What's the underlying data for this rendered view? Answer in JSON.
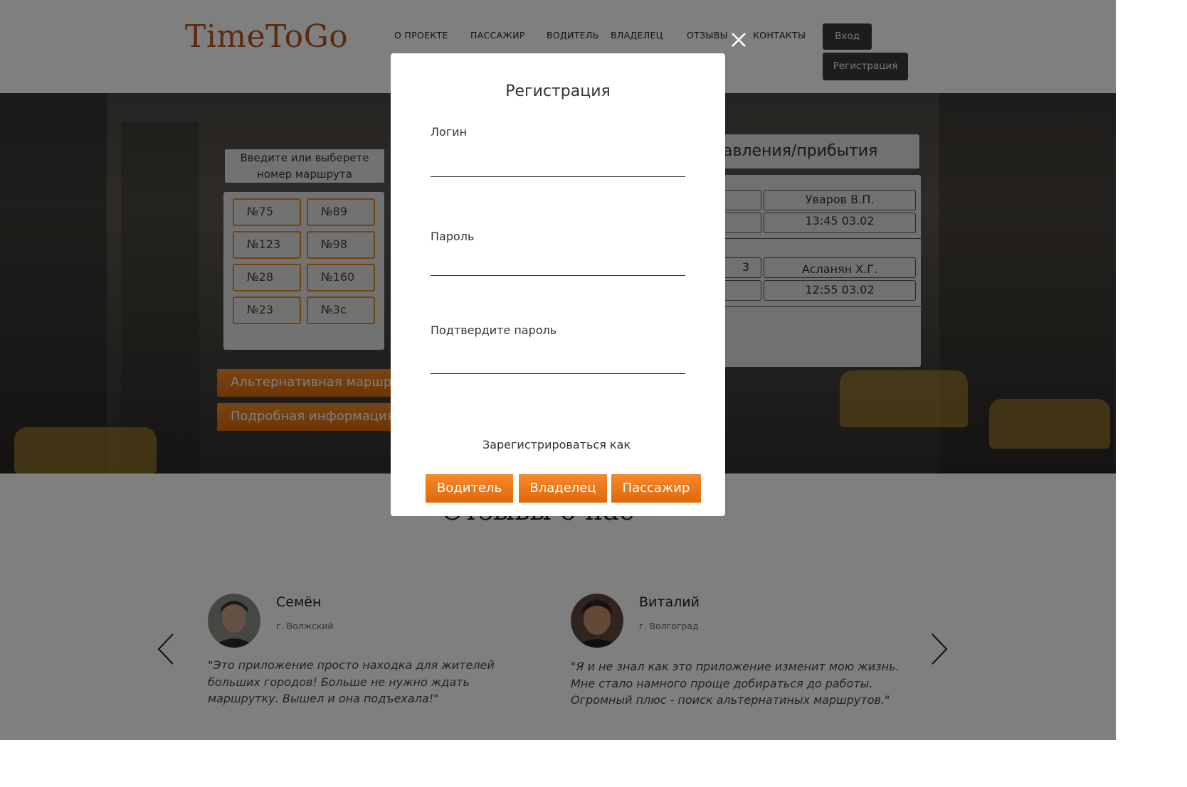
{
  "header": {
    "logo": "TimeToGo",
    "nav": [
      "О ПРОЕКТЕ",
      "ПАССАЖИР",
      "ВОДИТЕЛЬ",
      "ВЛАДЕЛЕЦ",
      "ОТЗЫВЫ",
      "КОНТАКТЫ"
    ],
    "login_label": "Вход",
    "register_label": "Регистрация"
  },
  "hero": {
    "route_prompt_line1": "Введите или выберете",
    "route_prompt_line2": "номер маршрута",
    "routes": [
      "№75",
      "№89",
      "№123",
      "№98",
      "№28",
      "№160",
      "№23",
      "№3с"
    ],
    "alt_route_label": "Альтернативная маршрут",
    "details_label": "Подробная информация",
    "schedule_title": "авления/прибытия",
    "schedule": [
      {
        "left_text": "",
        "driver": "Уваров В.П.",
        "time": "13:45 03.02"
      },
      {
        "left_text": "3",
        "driver": "Асланян Х.Г.",
        "time": "12:55 03.02"
      }
    ]
  },
  "reviews": {
    "title": "Отзывы о нас",
    "items": [
      {
        "name": "Семён",
        "city": "г. Волжский",
        "text": "\"Это приложение просто находка для жителей больших городов! Больше не нужно ждать маршрутку. Вышел и она подъехала!\""
      },
      {
        "name": "Виталий",
        "city": "г. Волгоград",
        "text": "\"Я и не знал как это приложение изменит мою жизнь. Мне стало намного проще добираться до работы. Огромный плюс - поиск альтернатиных маршрутов.\""
      }
    ]
  },
  "modal": {
    "title": "Регистрация",
    "login_label": "Логин",
    "login_value": "",
    "password_label": "Пароль",
    "password_value": "",
    "confirm_label": "Подтвердите пароль",
    "confirm_value": "",
    "register_as": "Зарегистрироваться как",
    "roles": [
      "Водитель",
      "Владелец",
      "Пассажир"
    ]
  },
  "colors": {
    "accent": "#e8750f",
    "logo": "#b8541a",
    "dark_button": "#3a3a3a",
    "overlay": "rgba(0,0,0,0.5)"
  },
  "icons": {
    "close": "close-icon",
    "prev": "chevron-left-icon",
    "next": "chevron-right-icon"
  }
}
